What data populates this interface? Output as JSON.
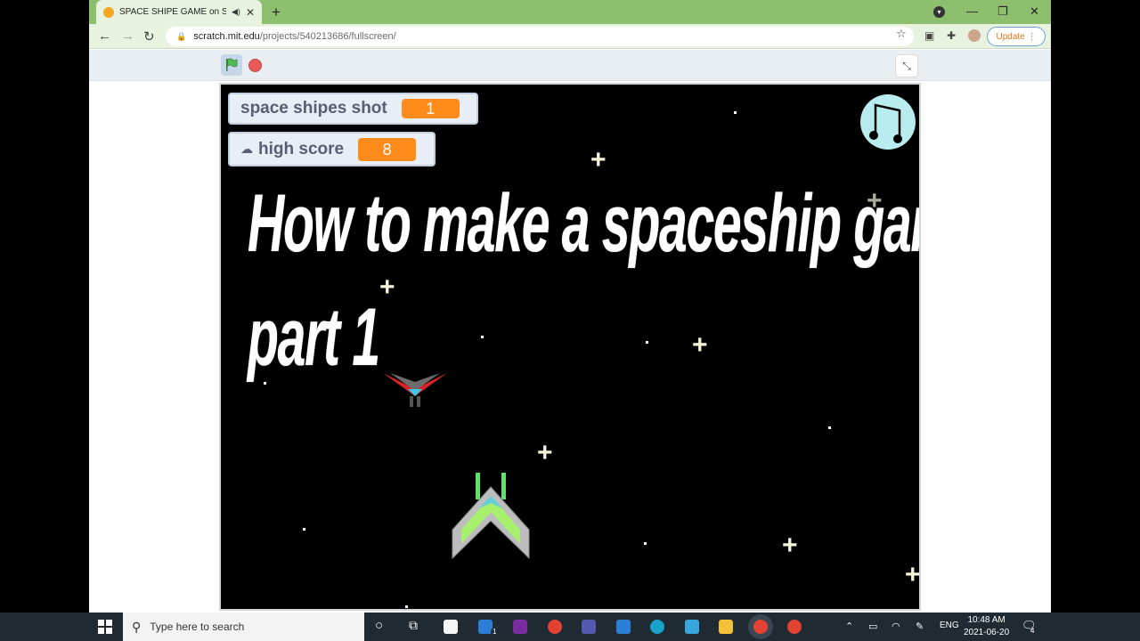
{
  "browser": {
    "tab_title": "SPACE SHIPE GAME on Scrat...",
    "url_domain": "scratch.mit.edu",
    "url_path": "/projects/540213686/fullscreen/",
    "update_label": "Update"
  },
  "game": {
    "monitors": [
      {
        "label": "space shipes shot",
        "value": "1"
      },
      {
        "label": "high score",
        "value": "8"
      }
    ],
    "title_line1": "How to make a spaceship game on scratch!",
    "title_line2": "part 1"
  },
  "taskbar": {
    "search_placeholder": "Type here to search",
    "language": "ENG",
    "time": "10:48 AM",
    "date": "2021-06-20",
    "mail_badge": "1",
    "notification_badge": "4"
  },
  "colors": {
    "tab_strip": "#8ebf6e",
    "monitor_value": "#ff8c1a",
    "stage": "#000000",
    "music_button": "#b8ecef"
  }
}
